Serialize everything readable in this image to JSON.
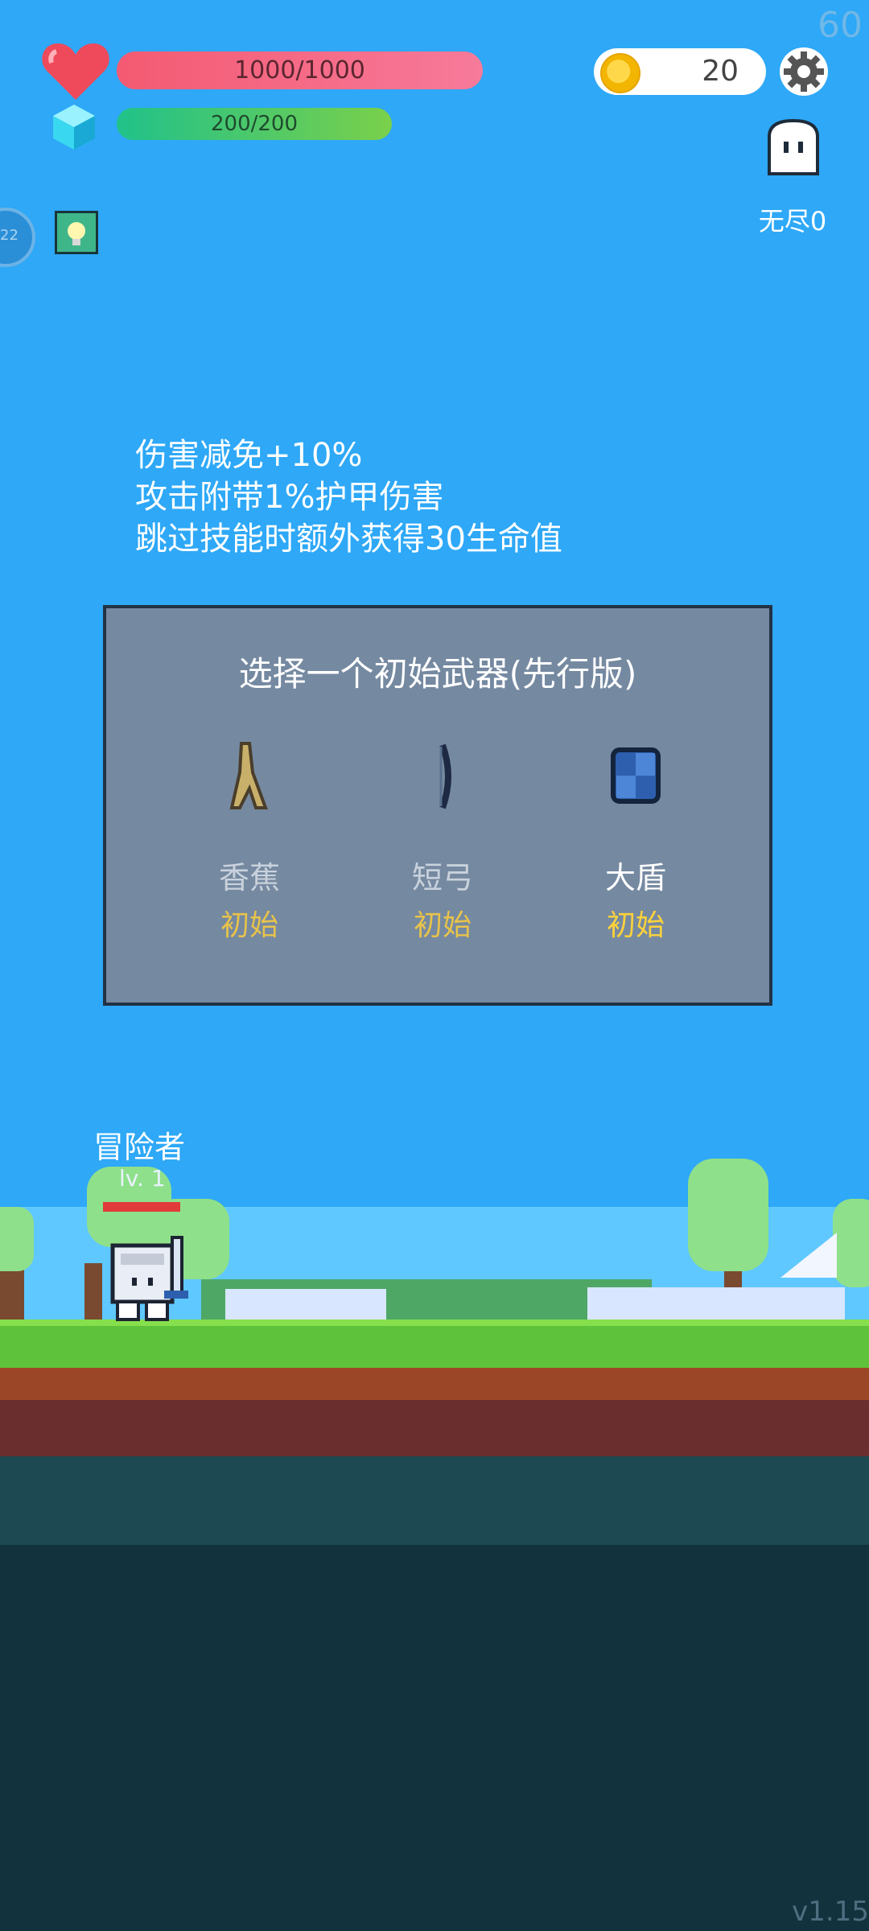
{
  "hud": {
    "hp_text": "1000/1000",
    "mp_text": "200/200",
    "hp_fraction": 1.0,
    "mp_fraction": 1.0,
    "coins": "20",
    "fps": "60",
    "mode_label": "无尽0",
    "buff_counter": "22"
  },
  "effects": [
    "伤害减免+10%",
    "攻击附带1%护甲伤害",
    "跳过技能时额外获得30生命值"
  ],
  "dialog": {
    "title": "选择一个初始武器(先行版)",
    "options": [
      {
        "name": "香蕉",
        "tag": "初始",
        "icon": "banana-icon"
      },
      {
        "name": "短弓",
        "tag": "初始",
        "icon": "bow-icon"
      },
      {
        "name": "大盾",
        "tag": "初始",
        "icon": "shield-icon"
      }
    ]
  },
  "player": {
    "name": "冒险者",
    "level": "lv. 1"
  },
  "version": "v1.15",
  "colors": {
    "sky": "#2ea8f7",
    "hp_bar": "#f45a72",
    "mp_bar": "#3cc77a",
    "tag_gold": "#e8c34a"
  }
}
